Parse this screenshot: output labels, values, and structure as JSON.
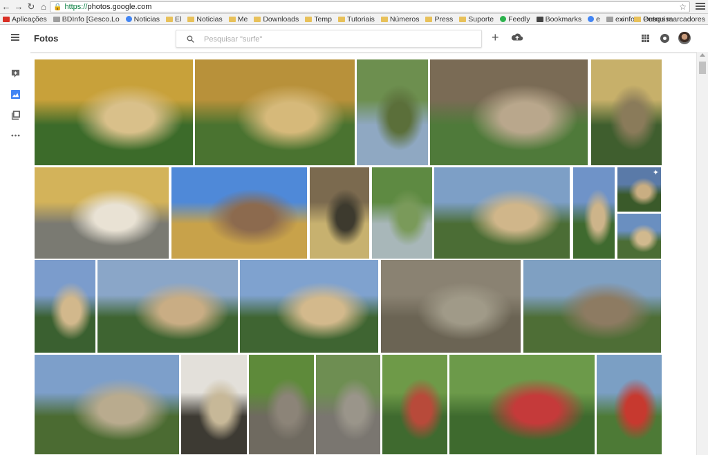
{
  "browser": {
    "url_https": "https://",
    "url_rest": "photos.google.com",
    "bookmarks": [
      {
        "label": "Aplicações",
        "icon": "apps-icon"
      },
      {
        "label": "BDInfo [Gesco.Lo",
        "icon": "page-icon"
      },
      {
        "label": "Noticias",
        "icon": "google-icon"
      },
      {
        "label": "El",
        "icon": "folder-icon"
      },
      {
        "label": "Noticias",
        "icon": "folder-icon"
      },
      {
        "label": "Me",
        "icon": "folder-icon"
      },
      {
        "label": "Downloads",
        "icon": "folder-icon"
      },
      {
        "label": "Temp",
        "icon": "folder-icon"
      },
      {
        "label": "Tutoriais",
        "icon": "folder-icon"
      },
      {
        "label": "Números",
        "icon": "folder-icon"
      },
      {
        "label": "Press",
        "icon": "folder-icon"
      },
      {
        "label": "Suporte",
        "icon": "folder-icon"
      },
      {
        "label": "Feedly",
        "icon": "feedly-icon"
      },
      {
        "label": "Bookmarks",
        "icon": "star-icon"
      },
      {
        "label": "e",
        "icon": "google-icon"
      },
      {
        "label": "exinfo. - Pesquisa",
        "icon": "page-icon"
      }
    ],
    "more_bookmarks": "»",
    "other_bookmarks": "Outros marcadores"
  },
  "app": {
    "title": "Fotos",
    "search_placeholder": "Pesquisar \"surfe\"",
    "add_icon": "+"
  },
  "sidebar": [
    {
      "icon": "assistant-icon"
    },
    {
      "icon": "photos-icon",
      "active": true
    },
    {
      "icon": "albums-icon"
    },
    {
      "icon": "more-icon"
    }
  ],
  "colors": {
    "accent": "#4285f4",
    "app_title": "#333333",
    "https_green": "#0b8043"
  }
}
